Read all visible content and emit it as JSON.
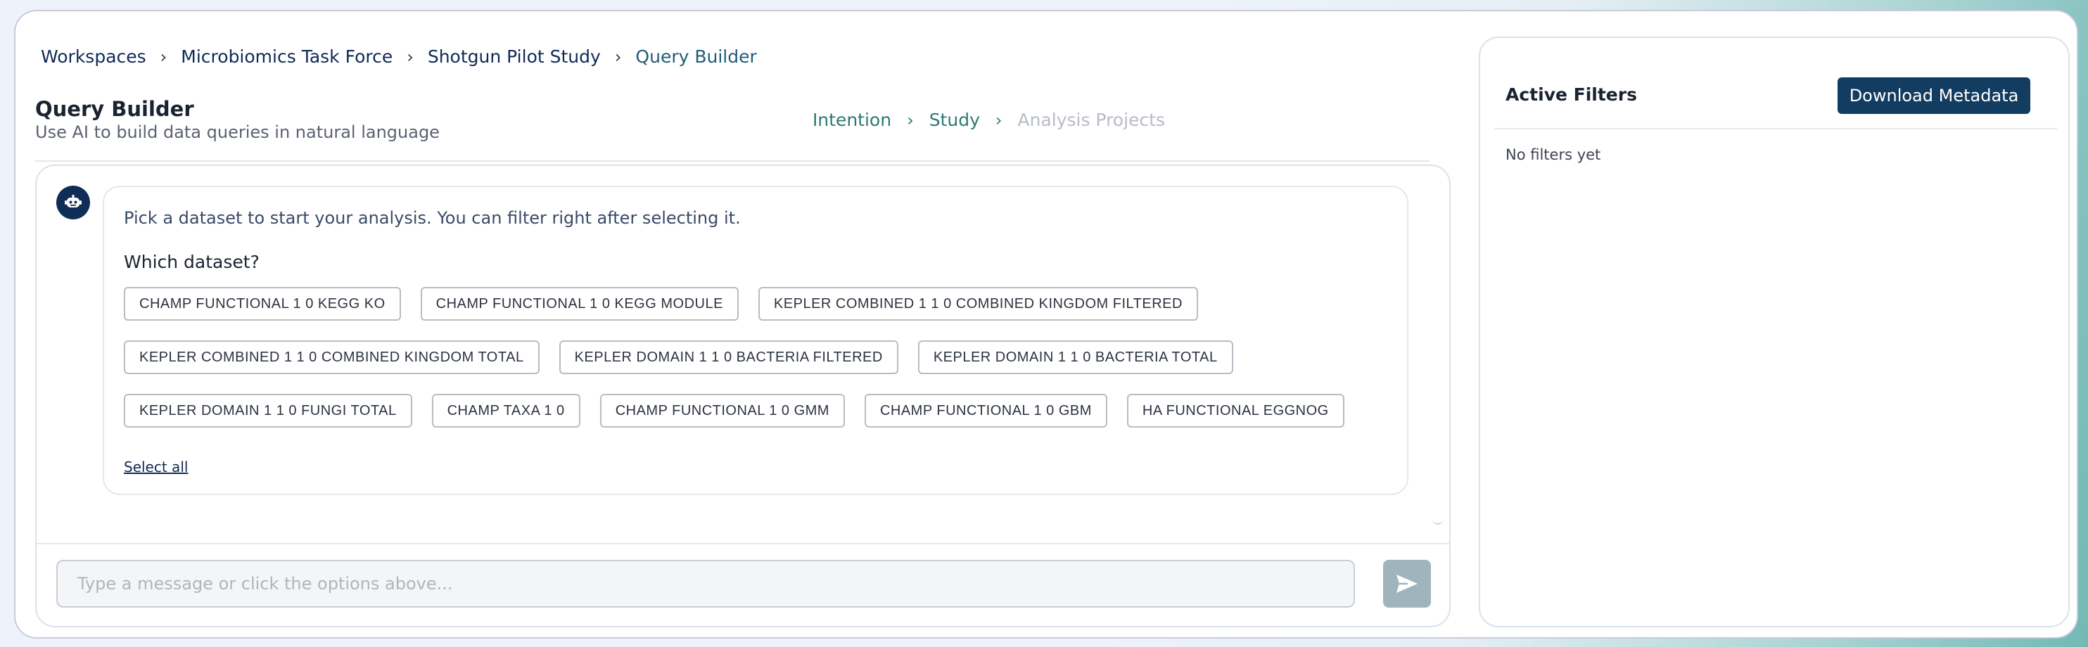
{
  "breadcrumb": {
    "items": [
      "Workspaces",
      "Microbiomics Task Force",
      "Shotgun Pilot Study"
    ],
    "current": "Query Builder",
    "separator": "›"
  },
  "header": {
    "title": "Query Builder",
    "subtitle": "Use AI to build data queries in natural language"
  },
  "steps": {
    "items": [
      {
        "label": "Intention",
        "state": "done"
      },
      {
        "label": "Study",
        "state": "done"
      },
      {
        "label": "Analysis Projects",
        "state": "upcoming"
      }
    ],
    "separator": "›"
  },
  "chat": {
    "avatar_icon": "robot-icon",
    "message": "Pick a dataset to start your analysis. You can filter right after selecting it.",
    "question": "Which dataset?",
    "option_rows": [
      [
        "CHAMP FUNCTIONAL 1 0 KEGG KO",
        "CHAMP FUNCTIONAL 1 0 KEGG MODULE",
        "KEPLER COMBINED 1 1 0 COMBINED KINGDOM FILTERED"
      ],
      [
        "KEPLER COMBINED 1 1 0 COMBINED KINGDOM TOTAL",
        "KEPLER DOMAIN 1 1 0 BACTERIA FILTERED",
        "KEPLER DOMAIN 1 1 0 BACTERIA TOTAL"
      ],
      [
        "KEPLER DOMAIN 1 1 0 FUNGI TOTAL",
        "CHAMP TAXA 1 0",
        "CHAMP FUNCTIONAL 1 0 GMM",
        "CHAMP FUNCTIONAL 1 0 GBM",
        "HA FUNCTIONAL EGGNOG"
      ]
    ],
    "select_all": "Select all",
    "input_placeholder": "Type a message or click the options above...",
    "input_value": "",
    "send_icon": "send-icon"
  },
  "filters": {
    "title": "Active Filters",
    "download_label": "Download Metadata",
    "empty_text": "No filters yet"
  },
  "colors": {
    "brand_dark": "#123c60",
    "accent_teal": "#2c7a72",
    "step_inactive": "#b7bcc5",
    "send_disabled": "#9fb4bd"
  }
}
